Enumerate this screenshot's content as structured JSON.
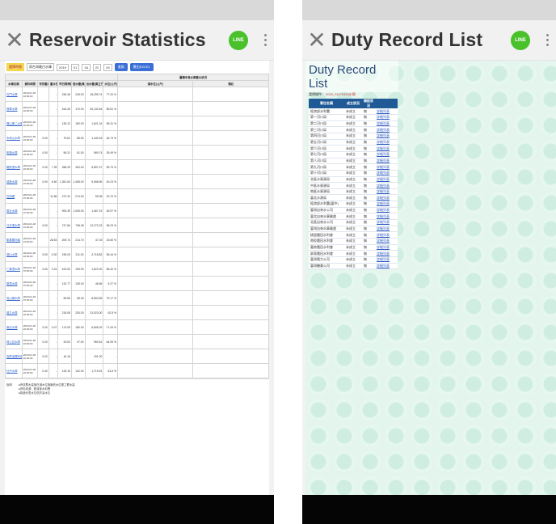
{
  "left": {
    "title": "Reservoir Statistics",
    "line_label": "LINE",
    "filter": {
      "label": "選擇時間",
      "reservoir": "雨台灣最白水庫",
      "year": "2019",
      "month": "01",
      "day": "18",
      "hour": "22",
      "minute": "00",
      "query": "查詢",
      "export": "匯出EXCEL"
    },
    "table": {
      "group_header": "臺灣本島水庫蓄水狀況",
      "headers": [
        "水庫名稱",
        "資料時間",
        "有效蓄水量(萬立方公尺)",
        "蓄水百分比",
        "昨日降雨量(mm)",
        "進水量(萬立方公尺)",
        "出水量(萬立方公尺)",
        "水位(公尺)",
        "滿水位(公尺)",
        "有效容量(萬立方公尺)",
        "備註"
      ],
      "rows": [
        {
          "name": "石門水庫",
          "time": "2019-01-18 22:00:00",
          "v1": "",
          "v2": "-",
          "v3": "236.36",
          "v4": "245.00",
          "v5": "18,259.74",
          "v6": "77.20 %"
        },
        {
          "name": "翡翠水庫",
          "time": "2019-01-18 22:00:00",
          "v1": "",
          "v2": "-",
          "v3": "164.26",
          "v4": "170.00",
          "v5": "30,132.64",
          "v6": "89.81 %"
        },
        {
          "name": "寶山第二水庫",
          "time": "2019-01-18 22:00:00",
          "v1": "",
          "v2": "-",
          "v3": "135.12",
          "v4": "150.00",
          "v5": "1,621.16",
          "v6": "55.31 %"
        },
        {
          "name": "永和山水庫",
          "time": "2019-01-18 22:00:00",
          "v1": "0.00",
          "v2": "-",
          "v3": "75.62",
          "v4": "85.00",
          "v5": "1,443.18",
          "v6": "46.73 %"
        },
        {
          "name": "明德水庫",
          "time": "2019-01-18 22:00:00",
          "v1": "0.00",
          "v2": "-",
          "v3": "56.31",
          "v4": "61.00",
          "v5": "569.74",
          "v6": "35.49 %"
        },
        {
          "name": "鯉魚潭水庫",
          "time": "2019-01-18 22:00:00",
          "v1": "0.00",
          "v2": "7.39",
          "v3": "286.29",
          "v4": "300.00",
          "v5": "6,897.47",
          "v6": "59.79 %"
        },
        {
          "name": "德基水庫",
          "time": "2019-01-18 07:00:00",
          "v1": "0.00",
          "v2": "6.50",
          "v3": "1,351.63",
          "v4": "1,408.00",
          "v5": "9,058.56",
          "v6": "40.23 %"
        },
        {
          "name": "石岡壩",
          "time": "2019-01-18 07:00:00",
          "v1": "",
          "v2": "11.86",
          "v3": "272.31",
          "v4": "274.00",
          "v5": "59.08",
          "v6": "20.70 %"
        },
        {
          "name": "霧社水庫",
          "time": "2019-01-18 07:00:00",
          "v1": "",
          "v2": "-",
          "v3": "994.39",
          "v4": "1,005.00",
          "v5": "1,467.19",
          "v6": "45.97 %"
        },
        {
          "name": "日月潭水庫",
          "time": "2019-01-18 21:00:00",
          "v1": "0.00",
          "v2": "-",
          "v3": "747.84",
          "v4": "748.48",
          "v5": "12,272.23",
          "v6": "96.23 %"
        },
        {
          "name": "集集攔河堰",
          "time": "2019-01-18 21:00:00",
          "v1": "",
          "v2": "28.53",
          "v3": "209.74",
          "v4": "214.70",
          "v5": "47.03",
          "v6": "15.60 %"
        },
        {
          "name": "湖山水庫",
          "time": "2019-01-18 22:00:00",
          "v1": "0.00",
          "v2": "0.00",
          "v3": "196.03",
          "v4": "211.00",
          "v5": "2,718.82",
          "v6": "55.44 %"
        },
        {
          "name": "仁義潭水庫",
          "time": "2019-01-18 07:00:00",
          "v1": "0.00",
          "v2": "0.24",
          "v3": "100.52",
          "v4": "105.00",
          "v5": "1,622.00",
          "v6": "66.40 %"
        },
        {
          "name": "蘭潭水庫",
          "time": "2019-01-18 07:00:00",
          "v1": "",
          "v2": "-",
          "v3": "132.77",
          "v4": "135.00",
          "v5": "46.56",
          "v6": "5.37 %"
        },
        {
          "name": "烏山頭水庫",
          "time": "2019-01-18 07:00:00",
          "v1": "",
          "v2": "-",
          "v3": "55.56",
          "v4": "58.18",
          "v5": "8,653.55",
          "v6": "79.17 %"
        },
        {
          "name": "曾文水庫",
          "time": "2019-01-18 22:00:00",
          "v1": "",
          "v2": "-",
          "v3": "218.08",
          "v4": "230.00",
          "v5": "31,923.00",
          "v6": "62.5 %"
        },
        {
          "name": "南化水庫",
          "time": "2019-01-18 22:00:00",
          "v1": "0.00",
          "v2": "0.07",
          "v3": "174.09",
          "v4": "180.00",
          "v5": "6,606.29",
          "v6": "71.26 %"
        },
        {
          "name": "阿公店水庫",
          "time": "2019-01-18 22:00:00",
          "v1": "0.20",
          "v2": "-",
          "v3": "33.54",
          "v4": "37.00",
          "v5": "960.61",
          "v6": "64.95 %"
        },
        {
          "name": "高屏溪攔河堰",
          "time": "2019-01-18 22:00:00",
          "v1": "0.02",
          "v2": "-",
          "v3": "16.16",
          "v4": "-",
          "v5": "151.20",
          "v6": "-"
        },
        {
          "name": "牡丹水庫",
          "time": "2019-01-18 22:00:00",
          "v1": "0.40",
          "v2": "-",
          "v3": "133.15",
          "v4": "142.00",
          "v5": "1,719.51",
          "v6": "61.6 %"
        }
      ]
    },
    "notes": {
      "label": "說明",
      "lines": [
        "●有效蓄水量指在滿水位與最低水位間之蓄水量",
        "●資料來源：經濟部水利署",
        "●負值代表水位低於呆水位"
      ]
    }
  },
  "right": {
    "title": "Duty Record List",
    "line_label": "LINE",
    "page_title": "Duty Record List",
    "condition_label": "選擇條件：",
    "condition_value": "2019_01170428水情",
    "headers": [
      "單位名稱",
      "成立狀況",
      "開設狀況"
    ],
    "rows": [
      {
        "unit": "經濟部水利署",
        "status": "未成立",
        "open": "無",
        "link": "詳細列表"
      },
      {
        "unit": "第一河川局",
        "status": "未成立",
        "open": "無",
        "link": "詳細列表"
      },
      {
        "unit": "第二河川局",
        "status": "未成立",
        "open": "無",
        "link": "詳細列表"
      },
      {
        "unit": "第三河川局",
        "status": "未成立",
        "open": "無",
        "link": "詳細列表"
      },
      {
        "unit": "第四河川局",
        "status": "未成立",
        "open": "無",
        "link": "詳細列表"
      },
      {
        "unit": "第五河川局",
        "status": "未成立",
        "open": "無",
        "link": "詳細列表"
      },
      {
        "unit": "第六河川局",
        "status": "未成立",
        "open": "無",
        "link": "詳細列表"
      },
      {
        "unit": "第七河川局",
        "status": "未成立",
        "open": "無",
        "link": "詳細列表"
      },
      {
        "unit": "第八河川局",
        "status": "未成立",
        "open": "無",
        "link": "詳細列表"
      },
      {
        "unit": "第九河川局",
        "status": "未成立",
        "open": "無",
        "link": "詳細列表"
      },
      {
        "unit": "第十河川局",
        "status": "未成立",
        "open": "無",
        "link": "詳細列表"
      },
      {
        "unit": "北區水資源局",
        "status": "未成立",
        "open": "無",
        "link": "詳細列表"
      },
      {
        "unit": "中區水資源局",
        "status": "未成立",
        "open": "無",
        "link": "詳細列表"
      },
      {
        "unit": "南區水資源局",
        "status": "未成立",
        "open": "無",
        "link": "詳細列表"
      },
      {
        "unit": "臺北水源局",
        "status": "未成立",
        "open": "無",
        "link": "詳細列表"
      },
      {
        "unit": "經濟部水利署(臺中)",
        "status": "未成立",
        "open": "無",
        "link": "詳細列表"
      },
      {
        "unit": "臺灣自來水公司",
        "status": "未成立",
        "open": "無",
        "link": "詳細列表"
      },
      {
        "unit": "臺北自來水事業處",
        "status": "未成立",
        "open": "無",
        "link": "詳細列表"
      },
      {
        "unit": "北區自來水公司",
        "status": "未成立",
        "open": "無",
        "link": "詳細列表"
      },
      {
        "unit": "臺灣自來水事業處",
        "status": "未成立",
        "open": "無",
        "link": "詳細列表"
      },
      {
        "unit": "桃園農田水利會",
        "status": "未成立",
        "open": "無",
        "link": "詳細列表"
      },
      {
        "unit": "南投農田水利會",
        "status": "未成立",
        "open": "無",
        "link": "詳細列表"
      },
      {
        "unit": "嘉南農田水利會",
        "status": "未成立",
        "open": "無",
        "link": "詳細列表"
      },
      {
        "unit": "屏東農田水利會",
        "status": "未成立",
        "open": "無",
        "link": "詳細列表"
      },
      {
        "unit": "臺灣電力公司",
        "status": "未成立",
        "open": "無",
        "link": "詳細列表"
      },
      {
        "unit": "臺灣糖業公司",
        "status": "未成立",
        "open": "無",
        "link": "詳細列表"
      }
    ]
  }
}
